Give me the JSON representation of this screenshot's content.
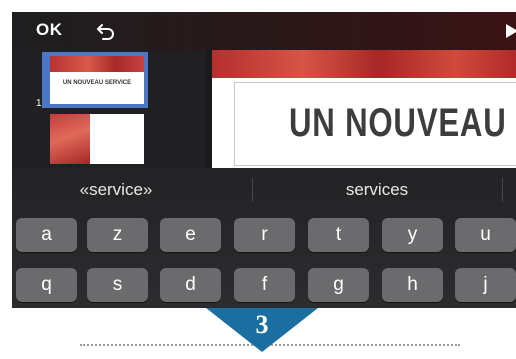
{
  "topbar": {
    "ok_label": "OK",
    "undo_icon": "undo-arrow-icon",
    "play_icon": "play-icon"
  },
  "thumbnails": [
    {
      "number": "1",
      "title": "UN NOUVEAU SERVICE",
      "selected": true
    },
    {
      "number": "",
      "title": "",
      "selected": false
    }
  ],
  "slide": {
    "title_visible": "UN NOUVEAU S"
  },
  "keyboard": {
    "suggestions": [
      "«service»",
      "services"
    ],
    "row1": [
      "a",
      "z",
      "e",
      "r",
      "t",
      "y",
      "u"
    ],
    "row2": [
      "q",
      "s",
      "d",
      "f",
      "g",
      "h",
      "j"
    ]
  },
  "step": {
    "number": "3",
    "color": "#1a6fa0"
  },
  "colors": {
    "selection": "#4a78c6",
    "slide_accent": "#c43c3c",
    "key": "#6b6b6e"
  }
}
